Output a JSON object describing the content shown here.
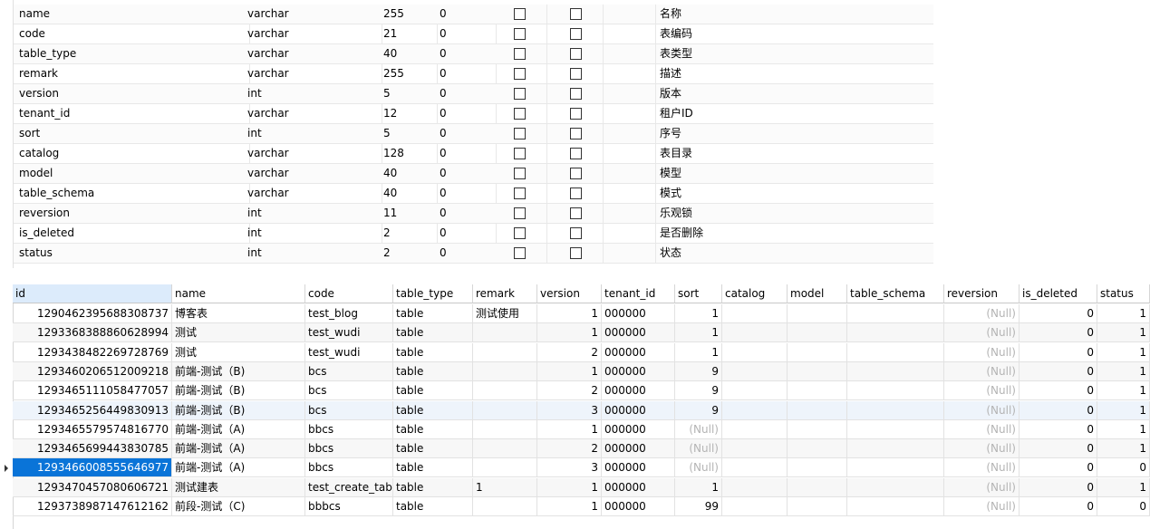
{
  "designer": {
    "fields": [
      {
        "name": "name",
        "type": "varchar",
        "length": "255",
        "decimals": "0",
        "comment": "名称"
      },
      {
        "name": "code",
        "type": "varchar",
        "length": "21",
        "decimals": "0",
        "comment": "表编码"
      },
      {
        "name": "table_type",
        "type": "varchar",
        "length": "40",
        "decimals": "0",
        "comment": "表类型"
      },
      {
        "name": "remark",
        "type": "varchar",
        "length": "255",
        "decimals": "0",
        "comment": "描述"
      },
      {
        "name": "version",
        "type": "int",
        "length": "5",
        "decimals": "0",
        "comment": "版本"
      },
      {
        "name": "tenant_id",
        "type": "varchar",
        "length": "12",
        "decimals": "0",
        "comment": "租户ID"
      },
      {
        "name": "sort",
        "type": "int",
        "length": "5",
        "decimals": "0",
        "comment": "序号"
      },
      {
        "name": "catalog",
        "type": "varchar",
        "length": "128",
        "decimals": "0",
        "comment": "表目录"
      },
      {
        "name": "model",
        "type": "varchar",
        "length": "40",
        "decimals": "0",
        "comment": "模型"
      },
      {
        "name": "table_schema",
        "type": "varchar",
        "length": "40",
        "decimals": "0",
        "comment": "模式"
      },
      {
        "name": "reversion",
        "type": "int",
        "length": "11",
        "decimals": "0",
        "comment": "乐观锁"
      },
      {
        "name": "is_deleted",
        "type": "int",
        "length": "2",
        "decimals": "0",
        "comment": "是否删除"
      },
      {
        "name": "status",
        "type": "int",
        "length": "2",
        "decimals": "0",
        "comment": "状态"
      }
    ]
  },
  "grid": {
    "columns": [
      "id",
      "name",
      "code",
      "table_type",
      "remark",
      "version",
      "tenant_id",
      "sort",
      "catalog",
      "model",
      "table_schema",
      "reversion",
      "is_deleted",
      "status"
    ],
    "null_text": "(Null)",
    "rows": [
      {
        "id": "1290462395688308737",
        "name": "博客表",
        "code": "test_blog",
        "table_type": "table",
        "remark": "测试使用",
        "version": "1",
        "tenant_id": "000000",
        "sort": "1",
        "reversion": "(Null)",
        "is_deleted": "0",
        "status": "1"
      },
      {
        "id": "1293368388860628994",
        "name": "测试",
        "code": "test_wudi",
        "table_type": "table",
        "remark": "",
        "version": "1",
        "tenant_id": "000000",
        "sort": "1",
        "reversion": "(Null)",
        "is_deleted": "0",
        "status": "1"
      },
      {
        "id": "1293438482269728769",
        "name": "测试",
        "code": "test_wudi",
        "table_type": "table",
        "remark": "",
        "version": "2",
        "tenant_id": "000000",
        "sort": "1",
        "reversion": "(Null)",
        "is_deleted": "0",
        "status": "1"
      },
      {
        "id": "1293460206512009218",
        "name": "前端-测试（B)",
        "code": "bcs",
        "table_type": "table",
        "remark": "",
        "version": "1",
        "tenant_id": "000000",
        "sort": "9",
        "reversion": "(Null)",
        "is_deleted": "0",
        "status": "1"
      },
      {
        "id": "1293465111058477057",
        "name": "前端-测试（B)",
        "code": "bcs",
        "table_type": "table",
        "remark": "",
        "version": "2",
        "tenant_id": "000000",
        "sort": "9",
        "reversion": "(Null)",
        "is_deleted": "0",
        "status": "1"
      },
      {
        "id": "1293465256449830913",
        "name": "前端-测试（B)",
        "code": "bcs",
        "table_type": "table",
        "remark": "",
        "version": "3",
        "tenant_id": "000000",
        "sort": "9",
        "reversion": "(Null)",
        "is_deleted": "0",
        "status": "1"
      },
      {
        "id": "1293465579574816770",
        "name": "前端-测试（A)",
        "code": "bbcs",
        "table_type": "table",
        "remark": "",
        "version": "1",
        "tenant_id": "000000",
        "sort": "(Null)",
        "reversion": "(Null)",
        "is_deleted": "0",
        "status": "1"
      },
      {
        "id": "1293465699443830785",
        "name": "前端-测试（A)",
        "code": "bbcs",
        "table_type": "table",
        "remark": "",
        "version": "2",
        "tenant_id": "000000",
        "sort": "(Null)",
        "reversion": "(Null)",
        "is_deleted": "0",
        "status": "1"
      },
      {
        "id": "1293466008555646977",
        "name": "前端-测试（A)",
        "code": "bbcs",
        "table_type": "table",
        "remark": "",
        "version": "3",
        "tenant_id": "000000",
        "sort": "(Null)",
        "reversion": "(Null)",
        "is_deleted": "0",
        "status": "0"
      },
      {
        "id": "1293470457080606721",
        "name": "测试建表",
        "code": "test_create_table",
        "table_type": "table",
        "remark": "1",
        "version": "1",
        "tenant_id": "000000",
        "sort": "1",
        "reversion": "(Null)",
        "is_deleted": "0",
        "status": "1"
      },
      {
        "id": "1293738987147612162",
        "name": "前段-测试（C)",
        "code": "bbbcs",
        "table_type": "table",
        "remark": "",
        "version": "1",
        "tenant_id": "000000",
        "sort": "99",
        "reversion": "(Null)",
        "is_deleted": "0",
        "status": "0"
      }
    ]
  },
  "colors": {
    "selection": "#0a74d8",
    "header_selected": "#dcebfb",
    "null_text": "#b4b4b4"
  }
}
